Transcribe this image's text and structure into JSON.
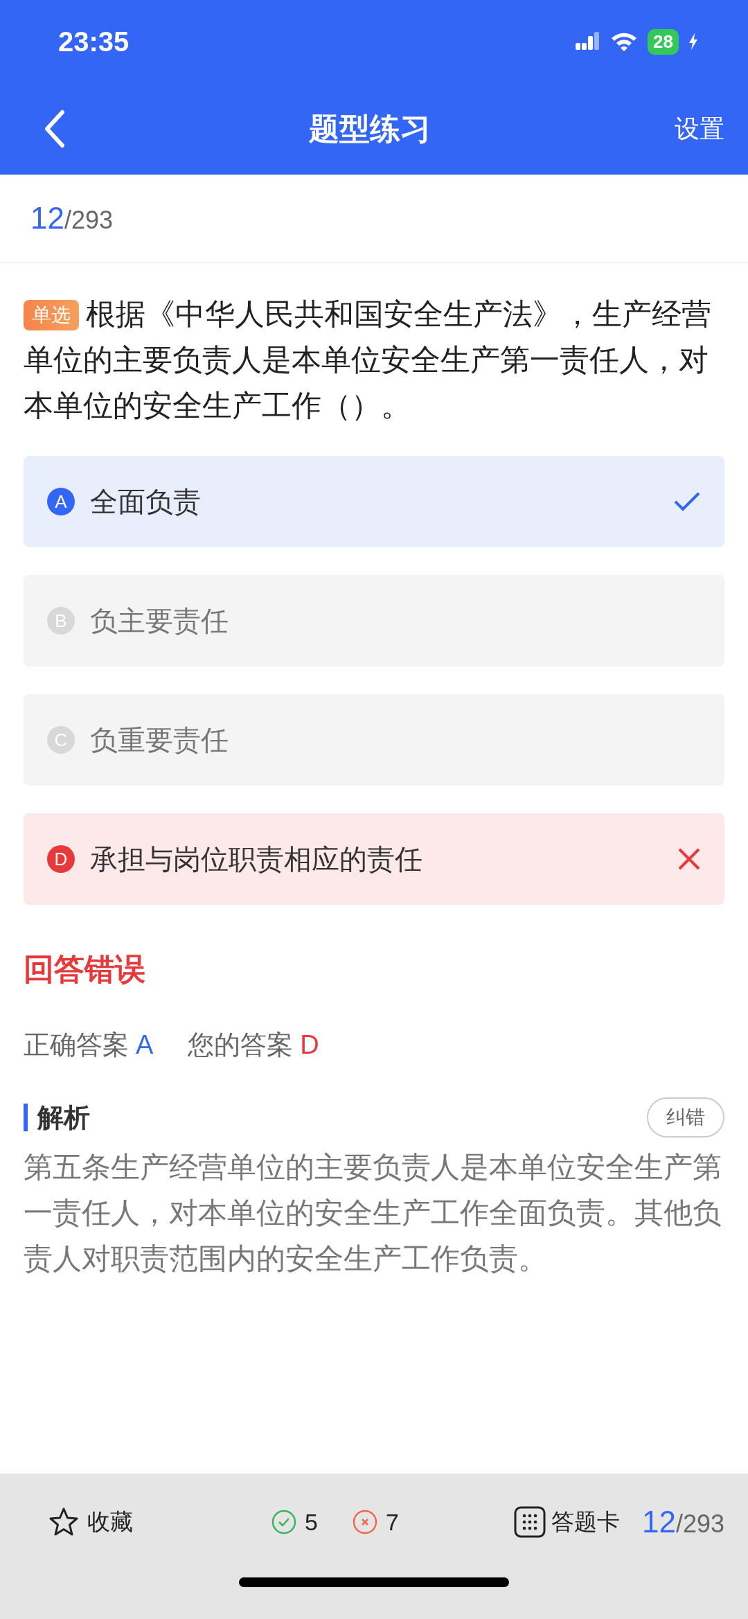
{
  "status_bar": {
    "time": "23:35",
    "battery": "28"
  },
  "nav": {
    "title": "题型练习",
    "action": "设置"
  },
  "progress": {
    "current": "12",
    "total": "/293"
  },
  "question": {
    "type": "单选",
    "text": "根据《中华人民共和国安全生产法》，生产经营单位的主要负责人是本单位安全生产第一责任人，对本单位的安全生产工作（）。"
  },
  "options": [
    {
      "letter": "A",
      "text": "全面负责",
      "kind": "correct"
    },
    {
      "letter": "B",
      "text": "负主要责任",
      "kind": "plain"
    },
    {
      "letter": "C",
      "text": "负重要责任",
      "kind": "plain"
    },
    {
      "letter": "D",
      "text": "承担与岗位职责相应的责任",
      "kind": "wrong"
    }
  ],
  "result": {
    "title": "回答错误",
    "correct_label": "正确答案",
    "correct": "A",
    "yours_label": "您的答案",
    "yours": "D"
  },
  "analysis": {
    "title": "解析",
    "report": "纠错",
    "text": "第五条生产经营单位的主要负责人是本单位安全生产第一责任人，对本单位的安全生产工作全面负责。其他负责人对职责范围内的安全生产工作负责。"
  },
  "bottom_bar": {
    "favorite": "收藏",
    "right_count": "5",
    "wrong_count": "7",
    "card": "答题卡",
    "current": "12",
    "total": "/293"
  }
}
